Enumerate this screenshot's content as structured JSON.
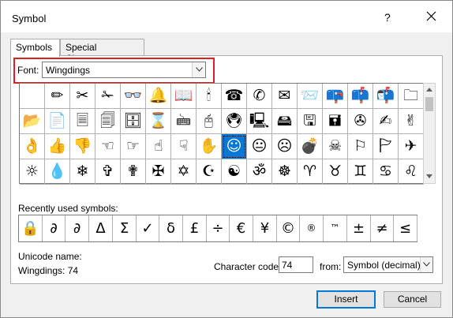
{
  "window": {
    "title": "Symbol",
    "help": "?"
  },
  "tabs": [
    {
      "label": "Symbols",
      "mnemonic": "y"
    },
    {
      "label": "Special Characters",
      "mnemonic": "P"
    }
  ],
  "font": {
    "label": "Font:",
    "value": "Wingdings"
  },
  "symbol_grid": [
    " ",
    "✏",
    "✂",
    "✁",
    "👓",
    "🔔",
    "📖",
    "🕯",
    "☎",
    "✆",
    "✉",
    "📨",
    "📪",
    "📫",
    "📬",
    "🗀",
    "📂",
    "📄",
    "🗏",
    "🗐",
    "🗄",
    "⌛",
    "🖮",
    "🖰",
    "🖲",
    "🖳",
    "🖴",
    "🖫",
    "🖬",
    "✇",
    "✍",
    "✌",
    "👌",
    "👍",
    "👎",
    "☜",
    "☞",
    "☝",
    "☟",
    "✋",
    "☺",
    "😐",
    "☹",
    "💣",
    "☠",
    "⚐",
    "🏱",
    "✈",
    "☼",
    "💧",
    "❄",
    "✞",
    "✟",
    "✠",
    "✡",
    "☪",
    "☯",
    "ॐ",
    "☸",
    "♈",
    "♉",
    "♊",
    "♋",
    "♌",
    "♍"
  ],
  "selected_index": 40,
  "recent": {
    "label": "Recently used symbols:",
    "items": [
      "🔒",
      "∂",
      "∂",
      "Δ",
      "Σ",
      "✓",
      "δ",
      "£",
      "÷",
      "€",
      "¥",
      "©",
      "®",
      "™",
      "±",
      "≠",
      "≤"
    ]
  },
  "unicode": {
    "label": "Unicode name:",
    "value": "Wingdings: 74"
  },
  "char_code": {
    "label": "Character code:",
    "value": "74"
  },
  "from": {
    "label": "from:",
    "value": "Symbol (decimal)"
  },
  "buttons": {
    "insert": "Insert",
    "cancel": "Cancel"
  }
}
